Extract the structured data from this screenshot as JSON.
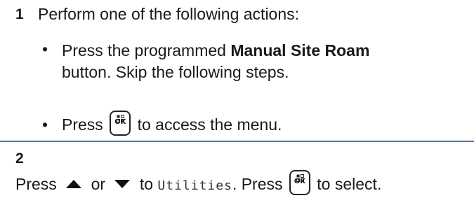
{
  "steps": [
    {
      "number": "1",
      "intro": "Perform one of the following actions:",
      "bullets": [
        {
          "symbol": "•",
          "prefix": "Press the programmed ",
          "bold": "Manual Site Roam",
          "line2": "button. Skip the following steps."
        },
        {
          "symbol": "•",
          "prefix": "Press",
          "icon": "menu-ok-key-icon",
          "suffix": "to access the menu."
        }
      ]
    },
    {
      "number": "2",
      "press_1": "Press",
      "up_icon": "up-arrow-icon",
      "or": "or",
      "down_icon": "down-arrow-icon",
      "to": "to",
      "menu_item": "Utilities",
      "press_2": ". Press",
      "ok_icon": "menu-ok-key-icon",
      "suffix": "to select."
    }
  ],
  "ok_key_label": "OK",
  "colors": {
    "divider": "#3b7fc4",
    "text": "#1a1a1a"
  }
}
